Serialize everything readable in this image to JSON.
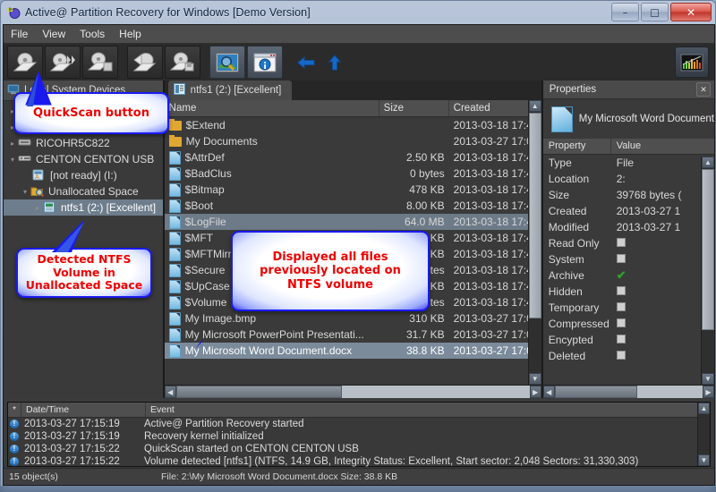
{
  "window": {
    "title": "Active@ Partition Recovery for Windows [Demo Version]",
    "icon": "app-icon",
    "minimize": "–",
    "maximize": "□",
    "close": "✕"
  },
  "menu": [
    "File",
    "View",
    "Tools",
    "Help"
  ],
  "toolbar": {
    "buttons": [
      {
        "name": "quickscan-button",
        "icon": "scan-disk-icon"
      },
      {
        "name": "superscan-button",
        "icon": "scan-fast-icon"
      },
      {
        "name": "save-scan-button",
        "icon": "scan-save-icon"
      },
      {
        "name": "recover-button",
        "icon": "recover-icon"
      },
      {
        "name": "save-button",
        "icon": "save-icon"
      },
      {
        "name": "preview-button",
        "icon": "preview-magnifier-icon"
      },
      {
        "name": "properties-button",
        "icon": "info-window-icon"
      },
      {
        "name": "back-button",
        "icon": "arrow-left-icon"
      },
      {
        "name": "up-button",
        "icon": "arrow-up-icon"
      },
      {
        "name": "disk-editor-button",
        "icon": "bar-chart-icon"
      }
    ]
  },
  "tree": {
    "header": "Local System Devices",
    "header_icon": "computer-icon",
    "items": [
      {
        "label": "",
        "icon": "",
        "indent": 1,
        "arrow": "▸",
        "hidden": true
      },
      {
        "label": "",
        "icon": "",
        "indent": 1,
        "arrow": "▸",
        "hidden": true
      },
      {
        "label": "RICOHR5C822",
        "icon": "device-icon",
        "indent": 1,
        "arrow": "▸"
      },
      {
        "label": "CENTON  CENTON USB",
        "icon": "usb-icon",
        "indent": 1,
        "arrow": "▾"
      },
      {
        "label": "[not ready] (I:)",
        "icon": "drive-warning-icon",
        "indent": 3,
        "arrow": ""
      },
      {
        "label": "Unallocated Space",
        "icon": "unallocated-icon",
        "indent": 2,
        "arrow": "▾"
      },
      {
        "label": "ntfs1 (2:) [Excellent]",
        "icon": "volume-icon",
        "indent": 3,
        "arrow": "▸",
        "selected": true
      }
    ]
  },
  "filelist": {
    "tab": {
      "label": "ntfs1 (2:) [Excellent]",
      "icon": "volume-list-icon"
    },
    "columns": [
      "Name",
      "Size",
      "Created"
    ],
    "rows": [
      {
        "name": "$Extend",
        "icon": "folder-icon",
        "size": "",
        "created": "2013-03-18 17:4..."
      },
      {
        "name": "My Documents",
        "icon": "folder-icon",
        "size": "",
        "created": "2013-03-27 17:0..."
      },
      {
        "name": "$AttrDef",
        "icon": "file-icon",
        "size": "2.50 KB",
        "created": "2013-03-18 17:4..."
      },
      {
        "name": "$BadClus",
        "icon": "file-icon",
        "size": "0 bytes",
        "created": "2013-03-18 17:4..."
      },
      {
        "name": "$Bitmap",
        "icon": "file-icon",
        "size": "478 KB",
        "created": "2013-03-18 17:4..."
      },
      {
        "name": "$Boot",
        "icon": "file-icon",
        "size": "8.00 KB",
        "created": "2013-03-18 17:4..."
      },
      {
        "name": "$LogFile",
        "icon": "file-icon",
        "size": "64.0 MB",
        "created": "2013-03-18 17:4...",
        "highlight": true
      },
      {
        "name": "$MFT",
        "icon": "file-icon",
        "size": "KB",
        "created": "2013-03-18 17:4..."
      },
      {
        "name": "$MFTMirr",
        "icon": "file-icon",
        "size": "KB",
        "created": "2013-03-18 17:4..."
      },
      {
        "name": "$Secure",
        "icon": "file-icon",
        "size": "tes",
        "created": "2013-03-18 17:4..."
      },
      {
        "name": "$UpCase",
        "icon": "file-icon",
        "size": "KB",
        "created": "2013-03-18 17:4..."
      },
      {
        "name": "$Volume",
        "icon": "file-icon",
        "size": "tes",
        "created": "2013-03-18 17:4..."
      },
      {
        "name": "My Image.bmp",
        "icon": "file-icon",
        "size": "310 KB",
        "created": "2013-03-27 17:0..."
      },
      {
        "name": "My Microsoft PowerPoint Presentati...",
        "icon": "file-icon",
        "size": "31.7 KB",
        "created": "2013-03-27 17:0..."
      },
      {
        "name": "My Microsoft Word Document.docx",
        "icon": "file-icon",
        "size": "38.8 KB",
        "created": "2013-03-27 17:0...",
        "selected": true
      }
    ]
  },
  "properties": {
    "title": "Properties",
    "close": "✕",
    "file_name": "My Microsoft Word Document",
    "file_icon": "document-icon",
    "columns": [
      "Property",
      "Value"
    ],
    "rows": [
      {
        "key": "Type",
        "value": "File"
      },
      {
        "key": "Location",
        "value": "2:"
      },
      {
        "key": "Size",
        "value": "39768 bytes ("
      },
      {
        "key": "Created",
        "value": "2013-03-27 1"
      },
      {
        "key": "Modified",
        "value": "2013-03-27 1"
      },
      {
        "key": "Read Only",
        "value": "",
        "check": "unchecked"
      },
      {
        "key": "System",
        "value": "",
        "check": "unchecked"
      },
      {
        "key": "Archive",
        "value": "",
        "check": "checked"
      },
      {
        "key": "Hidden",
        "value": "",
        "check": "unchecked"
      },
      {
        "key": "Temporary",
        "value": "",
        "check": "unchecked"
      },
      {
        "key": "Compressed",
        "value": "",
        "check": "unchecked"
      },
      {
        "key": "Encypted",
        "value": "",
        "check": "unchecked"
      },
      {
        "key": "Deleted",
        "value": "",
        "check": "unchecked"
      }
    ]
  },
  "log": {
    "columns": [
      "*",
      "Date/Time",
      "Event"
    ],
    "rows": [
      {
        "icon": "info-icon",
        "datetime": "2013-03-27 17:15:19",
        "event": "Active@ Partition Recovery started"
      },
      {
        "icon": "info-icon",
        "datetime": "2013-03-27 17:15:19",
        "event": "Recovery kernel initialized"
      },
      {
        "icon": "info-icon",
        "datetime": "2013-03-27 17:15:22",
        "event": "QuickScan started on CENTON  CENTON USB"
      },
      {
        "icon": "info-icon",
        "datetime": "2013-03-27 17:15:22",
        "event": "Volume detected [ntfs1] (NTFS, 14.9 GB, Integrity Status: Excellent, Start sector: 2,048 Sectors: 31,330,303)"
      }
    ]
  },
  "statusbar": {
    "objects": "15 object(s)",
    "file_info": "File: 2:\\My Microsoft Word Document.docx  Size: 38.8 KB"
  },
  "callouts": [
    {
      "id": "quickscan",
      "text": "QuickScan button"
    },
    {
      "id": "ntfs-volume",
      "text": "Detected NTFS Volume in Unallocated Space"
    },
    {
      "id": "files",
      "text": "Displayed all files previously located on NTFS volume"
    }
  ],
  "colors": {
    "callout_border": "#1a1aef",
    "callout_text": "#ee0000",
    "selection": "#7b8b9b",
    "checked": "#2ea02e"
  }
}
